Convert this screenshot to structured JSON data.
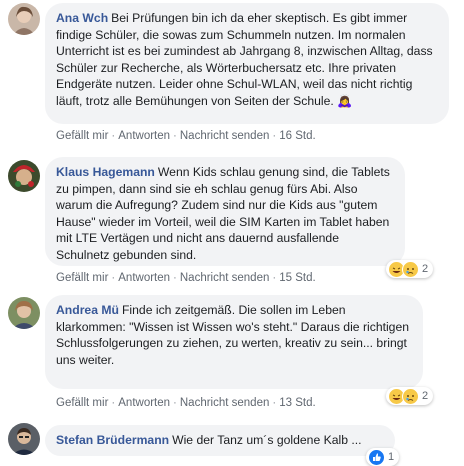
{
  "actions": {
    "like": "Gefällt mir",
    "reply": "Antworten",
    "message": "Nachricht senden",
    "separator": "·"
  },
  "comments": [
    {
      "author": "Ana Wch",
      "text": "Bei Prüfungen bin ich da eher skeptisch. Es gibt immer findige Schüler, die sowas zum Schummeln nutzen. Im normalen Unterricht ist es bei zumindest ab Jahrgang 8, inzwischen Alltag, dass Schüler zur Recherche, als Wörterbuchersatz etc. Ihre privaten Endgeräte nutzen. Leider ohne Schul-WLAN, weil das nicht richtig läuft, trotz alle Bemühungen von Seiten der Schule. 🙇‍♀️",
      "time": "16 Std."
    },
    {
      "author": "Klaus Hagemann",
      "text": "Wenn Kids schlau genung sind, die Tablets zu pimpen, dann sind sie eh schlau genug fürs Abi. Also warum die Aufregung? Zudem sind nur die Kids aus \"gutem Hause\" wieder im Vorteil, weil die SIM Karten im Tablet haben mit LTE Vertägen und nicht ans dauernd ausfallende Schulnetz gebunden sind.",
      "time": "15 Std.",
      "reaction_count": "2",
      "reaction_icons": [
        "haha-icon",
        "sad-icon"
      ]
    },
    {
      "author": "Andrea Mü",
      "text": "Finde ich zeitgemäß. Die sollen im Leben klarkommen: \"Wissen ist Wissen wo's steht.\" Daraus die richtigen Schlussfolgerungen zu ziehen, zu werten, kreativ zu sein... bringt uns weiter.",
      "time": "13 Std.",
      "reaction_count": "2",
      "reaction_icons": [
        "haha-icon",
        "sad-icon"
      ]
    },
    {
      "author": "Stefan Brüdermann",
      "text": "Wie der Tanz um´s goldene Kalb ...",
      "reaction_count": "1",
      "reaction_icons": [
        "like-icon"
      ]
    }
  ],
  "colors": {
    "author": "#385898",
    "bubble": "#f2f3f5",
    "meta": "#606770"
  }
}
